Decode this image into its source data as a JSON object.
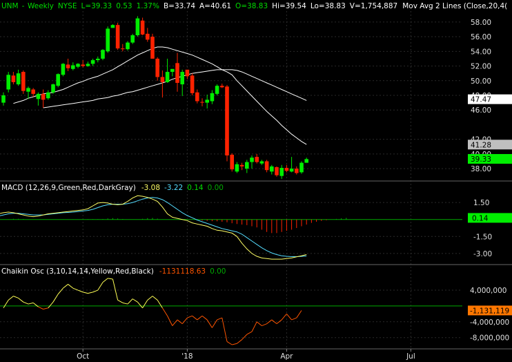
{
  "header": {
    "symbol": "UNM",
    "period": "Weekly",
    "exchange": "NYSE",
    "last": "L=39.33",
    "change": "0.53",
    "change_pct": "1.37%",
    "bid": "B=33.74",
    "ask": "A=40.61",
    "open": "O=38.83",
    "high": "Hi=39.54",
    "low": "Lo=38.83",
    "volume": "V=1,754,887",
    "ma_label": "Mov Avg 2 Lines (Close,20,4("
  },
  "colors": {
    "background": "#000000",
    "up": "#00ee00",
    "down": "#ff2200",
    "ma": "#ffffff",
    "grid": "#2a2a2a",
    "axis_text": "#e0e0e0",
    "title_green": "#00dd00",
    "title_white": "#ffffff",
    "macd_line": "#ffff66",
    "macd_signal": "#55ddff",
    "macd_hist_pos": "#00bb00",
    "macd_hist_neg": "#ff2200",
    "chaikin": "#ff5500",
    "chaikin_above": "#ffff55",
    "chaikin_zero": "#00aa00"
  },
  "chart_data": [
    {
      "type": "candlestick",
      "x_labels": [
        {
          "week": 16,
          "label": "Oct"
        },
        {
          "week": 37,
          "label": "'18"
        },
        {
          "week": 57,
          "label": "Apr"
        },
        {
          "week": 82,
          "label": "Jul"
        }
      ],
      "ylim": [
        36.5,
        59.5
      ],
      "y_ticks": [
        38.0,
        40.0,
        42.0,
        46.0,
        48.0,
        50.0,
        52.0,
        54.0,
        56.0,
        58.0
      ],
      "y_tick_labels": [
        "38.00",
        "40.00",
        "42.00",
        "46.00",
        "48.00",
        "50.00",
        "52.00",
        "54.00",
        "56.00",
        "58.00"
      ],
      "price_tags": [
        {
          "value": 47.47,
          "label": "47.47",
          "style": "white"
        },
        {
          "value": 41.28,
          "label": "41.28",
          "style": "gray"
        },
        {
          "value": 39.33,
          "label": "39.33",
          "style": "green"
        }
      ],
      "candles": [
        [
          47.0,
          48.4,
          46.6,
          48.0
        ],
        [
          48.8,
          51.2,
          48.4,
          50.8
        ],
        [
          50.7,
          51.2,
          49.5,
          49.8
        ],
        [
          49.5,
          51.5,
          49.3,
          51.0
        ],
        [
          51.2,
          51.4,
          48.2,
          48.6
        ],
        [
          48.5,
          49.2,
          47.5,
          49.0
        ],
        [
          48.8,
          49.0,
          47.8,
          48.2
        ],
        [
          47.5,
          48.4,
          46.6,
          48.2
        ],
        [
          48.2,
          48.8,
          46.3,
          47.4
        ],
        [
          47.6,
          48.7,
          47.4,
          48.4
        ],
        [
          48.4,
          49.6,
          48.2,
          49.5
        ],
        [
          49.3,
          51.0,
          49.1,
          50.9
        ],
        [
          50.8,
          52.4,
          50.6,
          52.3
        ],
        [
          52.2,
          53.0,
          51.3,
          51.7
        ],
        [
          51.6,
          52.5,
          51.4,
          52.1
        ],
        [
          51.9,
          52.4,
          51.7,
          52.3
        ],
        [
          52.2,
          52.8,
          51.8,
          52.0
        ],
        [
          52.0,
          52.6,
          51.9,
          52.3
        ],
        [
          52.3,
          53.0,
          52.0,
          52.8
        ],
        [
          52.8,
          53.3,
          52.5,
          53.0
        ],
        [
          53.0,
          54.3,
          52.8,
          54.2
        ],
        [
          54.0,
          57.4,
          53.8,
          57.1
        ],
        [
          57.2,
          57.7,
          57.2,
          57.6
        ],
        [
          57.6,
          57.9,
          54.2,
          54.4
        ],
        [
          54.4,
          55.0,
          54.0,
          54.3
        ],
        [
          54.3,
          55.4,
          54.1,
          55.2
        ],
        [
          55.2,
          56.4,
          55.0,
          56.2
        ],
        [
          56.2,
          58.8,
          56.0,
          58.5
        ],
        [
          58.2,
          58.6,
          56.2,
          56.3
        ],
        [
          56.4,
          57.2,
          55.3,
          55.6
        ],
        [
          56.0,
          56.4,
          54.0,
          53.0
        ],
        [
          53.0,
          53.2,
          50.0,
          50.5
        ],
        [
          50.5,
          51.4,
          47.7,
          49.8
        ],
        [
          49.8,
          53.0,
          49.7,
          51.2
        ],
        [
          51.2,
          51.6,
          50.6,
          51.6
        ],
        [
          52.4,
          53.8,
          48.5,
          49.7
        ],
        [
          49.5,
          51.5,
          47.9,
          51.2
        ],
        [
          51.5,
          51.5,
          50.2,
          50.6
        ],
        [
          50.7,
          51.0,
          48.0,
          48.3
        ],
        [
          48.4,
          48.8,
          46.9,
          47.2
        ],
        [
          47.1,
          47.6,
          46.5,
          47.0
        ],
        [
          47.0,
          48.1,
          46.2,
          47.4
        ],
        [
          47.2,
          48.7,
          46.8,
          48.3
        ],
        [
          48.2,
          49.5,
          48.0,
          49.3
        ],
        [
          49.3,
          49.6,
          49.0,
          49.1
        ],
        [
          49.2,
          49.4,
          39.0,
          39.8
        ],
        [
          39.9,
          40.1,
          37.6,
          37.9
        ],
        [
          37.6,
          38.9,
          37.4,
          38.6
        ],
        [
          38.5,
          38.8,
          37.8,
          38.3
        ],
        [
          38.0,
          39.2,
          37.4,
          38.9
        ],
        [
          38.9,
          39.8,
          38.0,
          39.5
        ],
        [
          39.6,
          40.0,
          38.7,
          38.9
        ],
        [
          38.7,
          39.2,
          38.5,
          39.0
        ],
        [
          39.0,
          39.2,
          37.5,
          37.8
        ],
        [
          37.6,
          38.5,
          37.2,
          38.3
        ],
        [
          38.2,
          38.3,
          36.9,
          37.1
        ],
        [
          37.0,
          38.5,
          36.6,
          38.1
        ],
        [
          38.1,
          38.5,
          37.5,
          37.7
        ],
        [
          37.6,
          39.6,
          37.5,
          38.0
        ],
        [
          38.0,
          38.3,
          37.2,
          37.4
        ],
        [
          37.5,
          39.0,
          37.3,
          38.8
        ],
        [
          38.8,
          39.5,
          38.8,
          39.3
        ]
      ],
      "ma20": [
        46.9,
        47.1,
        47.3,
        47.6,
        47.8,
        48.0,
        48.2,
        48.3,
        48.4,
        48.6,
        48.8,
        49.1,
        49.4,
        49.7,
        49.9,
        50.2,
        50.4,
        50.6,
        50.9,
        51.2,
        51.5,
        51.9,
        52.3,
        52.7,
        53.1,
        53.5,
        53.8,
        54.1,
        54.4,
        54.6,
        54.6,
        54.5,
        54.3,
        54.1,
        53.9,
        53.7,
        53.5,
        53.2,
        52.9,
        52.6,
        52.3,
        51.9,
        51.5,
        51.2,
        50.8,
        50.0,
        49.3,
        48.6,
        47.9,
        47.2,
        46.5,
        45.8,
        45.2,
        44.6,
        43.9,
        43.3,
        42.7,
        42.2,
        41.7,
        41.3
      ],
      "ma40": [
        46.3,
        46.4,
        46.5,
        46.6,
        46.7,
        46.8,
        46.9,
        47.0,
        47.1,
        47.2,
        47.3,
        47.5,
        47.6,
        47.7,
        47.9,
        48.0,
        48.2,
        48.4,
        48.5,
        48.7,
        48.9,
        49.1,
        49.3,
        49.5,
        49.7,
        49.9,
        50.2,
        50.4,
        50.6,
        50.8,
        51.0,
        51.1,
        51.2,
        51.3,
        51.4,
        51.5,
        51.5,
        51.5,
        51.5,
        51.4,
        51.2,
        50.9,
        50.6,
        50.3,
        50.0,
        49.7,
        49.4,
        49.1,
        48.8,
        48.5,
        48.2,
        47.9,
        47.6,
        47.3
      ]
    },
    {
      "type": "line",
      "title": "MACD (12,26,9,Green,Red,DarkGray)",
      "macd_value": "-3.08",
      "signal_value": "-3.22",
      "hist_value": "0.14",
      "zero_value": "0.00",
      "ylim": [
        -3.8,
        2.3
      ],
      "y_ticks": [
        1.5,
        -1.5,
        -3.0
      ],
      "y_tick_labels": [
        "1.50",
        "-1.50",
        "-3.00"
      ],
      "price_tag": {
        "value": 0.14,
        "label": "0.14"
      },
      "macd": [
        0.1,
        0.3,
        0.5,
        0.6,
        0.65,
        0.6,
        0.5,
        0.4,
        0.3,
        0.25,
        0.3,
        0.4,
        0.5,
        0.55,
        0.6,
        0.65,
        0.7,
        0.75,
        0.8,
        0.85,
        0.95,
        1.2,
        1.45,
        1.5,
        1.45,
        1.35,
        1.3,
        1.35,
        1.6,
        1.9,
        2.1,
        2.05,
        1.95,
        1.8,
        1.6,
        1.1,
        0.5,
        0.2,
        0.1,
        0.0,
        -0.1,
        -0.3,
        -0.4,
        -0.5,
        -0.6,
        -0.8,
        -0.95,
        -1.0,
        -1.1,
        -1.2,
        -1.5,
        -2.1,
        -2.6,
        -3.0,
        -3.25,
        -3.4,
        -3.45,
        -3.5,
        -3.5,
        -3.5,
        -3.45,
        -3.4,
        -3.3,
        -3.2,
        -3.1
      ],
      "signal": [
        0.2,
        0.25,
        0.3,
        0.4,
        0.5,
        0.55,
        0.55,
        0.5,
        0.45,
        0.4,
        0.4,
        0.4,
        0.45,
        0.5,
        0.55,
        0.6,
        0.62,
        0.65,
        0.7,
        0.75,
        0.8,
        0.9,
        1.05,
        1.2,
        1.3,
        1.35,
        1.35,
        1.35,
        1.4,
        1.5,
        1.65,
        1.8,
        1.9,
        1.95,
        1.9,
        1.75,
        1.5,
        1.2,
        0.9,
        0.6,
        0.35,
        0.15,
        -0.05,
        -0.2,
        -0.35,
        -0.5,
        -0.65,
        -0.8,
        -0.9,
        -1.0,
        -1.1,
        -1.3,
        -1.6,
        -1.9,
        -2.2,
        -2.5,
        -2.75,
        -2.95,
        -3.1,
        -3.2,
        -3.25,
        -3.28,
        -3.28,
        -3.26,
        -3.22
      ],
      "hist_start_week": 40,
      "hist": [
        -0.1,
        -0.12,
        -0.15,
        -0.16,
        -0.2,
        -0.25,
        -0.33,
        -0.4,
        -0.45,
        -0.5,
        -0.6,
        -0.7,
        -0.9,
        -1.1,
        -1.2,
        -1.2,
        -1.1,
        -1.0,
        -0.9,
        -0.75,
        -0.6,
        -0.45,
        -0.3,
        -0.2,
        -0.12,
        -0.06,
        0.0,
        0.05,
        0.1,
        0.14
      ]
    },
    {
      "type": "line",
      "title": "Chaikin Osc (3,10,14,14,Yellow,Red,Black)",
      "value": "-1131118.63",
      "zero_value": "0.00",
      "ylim": [
        -10500000,
        7500000
      ],
      "y_ticks": [
        4000000,
        -4000000,
        -8000000
      ],
      "y_tick_labels": [
        "4,000,000",
        "-4,000,000",
        "-8,000,000"
      ],
      "price_tag": {
        "value": -1131119,
        "label": "-1,131,119"
      },
      "values": [
        -500000,
        1500000,
        2500000,
        2000000,
        1000000,
        500000,
        800000,
        -200000,
        -800000,
        -500000,
        1000000,
        3000000,
        4500000,
        5500000,
        4500000,
        4000000,
        3500000,
        3200000,
        3500000,
        4000000,
        6000000,
        7000000,
        6800000,
        1500000,
        800000,
        500000,
        1800000,
        1000000,
        -500000,
        1500000,
        2500000,
        1500000,
        -500000,
        -2500000,
        -5000000,
        -3500000,
        -4500000,
        -3000000,
        -2500000,
        -3500000,
        -2500000,
        -3500000,
        -5500000,
        -3500000,
        -3000000,
        -9000000,
        -9800000,
        -9500000,
        -8500000,
        -7200000,
        -6500000,
        -4000000,
        -5000000,
        -4500000,
        -3500000,
        -4500000,
        -3500000,
        -2000000,
        -3500000,
        -3000000,
        -1131119
      ],
      "start_week": 0
    }
  ]
}
